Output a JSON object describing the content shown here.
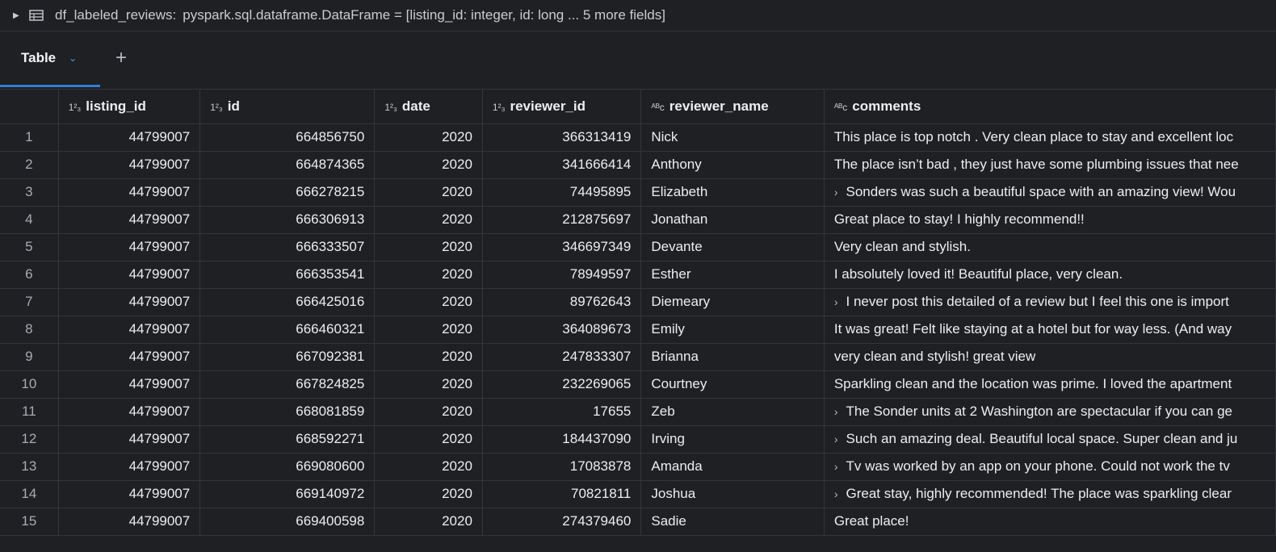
{
  "df_header": {
    "name": "df_labeled_reviews:",
    "schema": "pyspark.sql.dataframe.DataFrame = [listing_id: integer, id: long ... 5 more fields]"
  },
  "tabs": {
    "table_label": "Table",
    "add_label": "+"
  },
  "columns": [
    {
      "type": "1²₃",
      "name": "listing_id"
    },
    {
      "type": "1²₃",
      "name": "id"
    },
    {
      "type": "1²₃",
      "name": "date"
    },
    {
      "type": "1²₃",
      "name": "reviewer_id"
    },
    {
      "type": "ᴬᴮc",
      "name": "reviewer_name"
    },
    {
      "type": "ᴬᴮc",
      "name": "comments"
    }
  ],
  "rows": [
    {
      "n": "1",
      "listing_id": "44799007",
      "id": "664856750",
      "date": "2020",
      "reviewer_id": "366313419",
      "reviewer_name": "Nick",
      "expand": "",
      "comments": "This place is top notch . Very clean place to stay and excellent loc"
    },
    {
      "n": "2",
      "listing_id": "44799007",
      "id": "664874365",
      "date": "2020",
      "reviewer_id": "341666414",
      "reviewer_name": "Anthony",
      "expand": "",
      "comments": "The place isn’t bad , they just have some plumbing issues that nee"
    },
    {
      "n": "3",
      "listing_id": "44799007",
      "id": "666278215",
      "date": "2020",
      "reviewer_id": "74495895",
      "reviewer_name": "Elizabeth",
      "expand": "›",
      "comments": "Sonders was such a beautiful space with an amazing view! Wou"
    },
    {
      "n": "4",
      "listing_id": "44799007",
      "id": "666306913",
      "date": "2020",
      "reviewer_id": "212875697",
      "reviewer_name": "Jonathan",
      "expand": "",
      "comments": "Great place to stay! I highly recommend!!"
    },
    {
      "n": "5",
      "listing_id": "44799007",
      "id": "666333507",
      "date": "2020",
      "reviewer_id": "346697349",
      "reviewer_name": "Devante",
      "expand": "",
      "comments": "Very clean and stylish."
    },
    {
      "n": "6",
      "listing_id": "44799007",
      "id": "666353541",
      "date": "2020",
      "reviewer_id": "78949597",
      "reviewer_name": "Esther",
      "expand": "",
      "comments": "I absolutely loved it! Beautiful place, very clean."
    },
    {
      "n": "7",
      "listing_id": "44799007",
      "id": "666425016",
      "date": "2020",
      "reviewer_id": "89762643",
      "reviewer_name": "Diemeary",
      "expand": "›",
      "comments": "I never post this detailed of a review but I feel this one is import"
    },
    {
      "n": "8",
      "listing_id": "44799007",
      "id": "666460321",
      "date": "2020",
      "reviewer_id": "364089673",
      "reviewer_name": "Emily",
      "expand": "",
      "comments": "It was great! Felt like staying at a hotel but for way less. (And way"
    },
    {
      "n": "9",
      "listing_id": "44799007",
      "id": "667092381",
      "date": "2020",
      "reviewer_id": "247833307",
      "reviewer_name": "Brianna",
      "expand": "",
      "comments": "very clean and stylish! great view"
    },
    {
      "n": "10",
      "listing_id": "44799007",
      "id": "667824825",
      "date": "2020",
      "reviewer_id": "232269065",
      "reviewer_name": "Courtney",
      "expand": "",
      "comments": "Sparkling clean and the location was prime. I loved the apartment"
    },
    {
      "n": "11",
      "listing_id": "44799007",
      "id": "668081859",
      "date": "2020",
      "reviewer_id": "17655",
      "reviewer_name": "Zeb",
      "expand": "›",
      "comments": "The Sonder units at 2 Washington are spectacular if you can ge"
    },
    {
      "n": "12",
      "listing_id": "44799007",
      "id": "668592271",
      "date": "2020",
      "reviewer_id": "184437090",
      "reviewer_name": "Irving",
      "expand": "›",
      "comments": "Such an amazing deal. Beautiful local space. Super clean and ju"
    },
    {
      "n": "13",
      "listing_id": "44799007",
      "id": "669080600",
      "date": "2020",
      "reviewer_id": "17083878",
      "reviewer_name": "Amanda",
      "expand": "›",
      "comments": "Tv was worked by an app on your phone. Could not work the tv"
    },
    {
      "n": "14",
      "listing_id": "44799007",
      "id": "669140972",
      "date": "2020",
      "reviewer_id": "70821811",
      "reviewer_name": "Joshua",
      "expand": "›",
      "comments": "Great stay, highly recommended! The place was sparkling clear"
    },
    {
      "n": "15",
      "listing_id": "44799007",
      "id": "669400598",
      "date": "2020",
      "reviewer_id": "274379460",
      "reviewer_name": "Sadie",
      "expand": "",
      "comments": "Great place!"
    }
  ]
}
